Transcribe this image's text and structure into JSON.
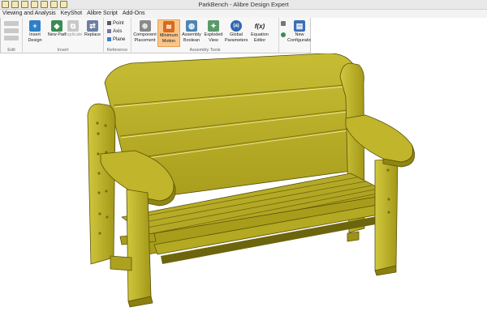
{
  "window": {
    "title": "ParkBench - Alibre Design Expert"
  },
  "menu": [
    "Viewing and Analysis",
    "KeyShot",
    "Alibre Script",
    "Add-Ons"
  ],
  "ribbon": {
    "groups": {
      "edit": "Edit",
      "insert": "Insert",
      "reference": "Reference",
      "assembly_tools": "Assembly Tools"
    },
    "buttons": {
      "insert_design": "Insert Design",
      "new_part": "New Part",
      "duplicate": "Duplicate",
      "replace": "Replace",
      "point": "Point",
      "axis": "Axis",
      "plane": "Plane",
      "component_placement": "Component Placement",
      "minimum_motion": "Minimum Motion",
      "assembly_boolean": "Assembly Boolean",
      "exploded_view": "Exploded View",
      "global_parameters": "Global Parameters",
      "equation_editor": "Equation Editor",
      "new_configuration": "New Configuration"
    },
    "icons": {
      "global_parameters": "(a)",
      "equation_editor": "f(x)"
    }
  },
  "colors": {
    "bench": "#b7ac1f",
    "bench_light": "#cfc43a",
    "bench_dark": "#7a7010",
    "active_button": "#f8c58a"
  }
}
